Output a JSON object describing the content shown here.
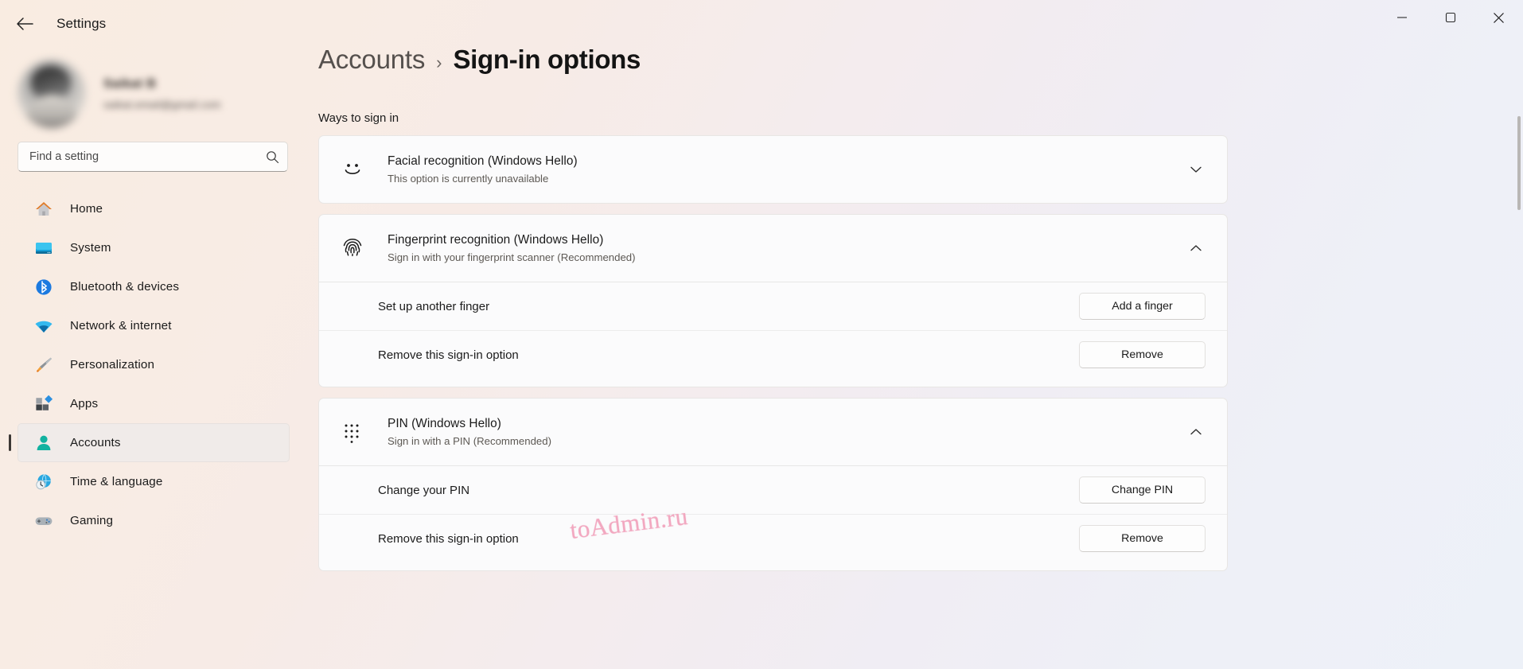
{
  "window": {
    "app_title": "Settings",
    "back_icon": "back-arrow-icon",
    "minimize_label": "—",
    "maximize_label": "☐",
    "close_label": "✕"
  },
  "profile": {
    "name": "Saikat B",
    "email": "saikat.email@gmail.com"
  },
  "search": {
    "placeholder": "Find a setting",
    "value": "",
    "icon": "search-icon"
  },
  "sidebar": {
    "items": [
      {
        "label": "Home",
        "icon": "home-icon",
        "selected": false
      },
      {
        "label": "System",
        "icon": "system-icon",
        "selected": false
      },
      {
        "label": "Bluetooth & devices",
        "icon": "bluetooth-icon",
        "selected": false
      },
      {
        "label": "Network & internet",
        "icon": "wifi-icon",
        "selected": false
      },
      {
        "label": "Personalization",
        "icon": "paintbrush-icon",
        "selected": false
      },
      {
        "label": "Apps",
        "icon": "apps-icon",
        "selected": false
      },
      {
        "label": "Accounts",
        "icon": "account-person-icon",
        "selected": true
      },
      {
        "label": "Time & language",
        "icon": "clock-globe-icon",
        "selected": false
      },
      {
        "label": "Gaming",
        "icon": "gamepad-icon",
        "selected": false
      }
    ]
  },
  "main": {
    "breadcrumb_parent": "Accounts",
    "breadcrumb_separator": "›",
    "breadcrumb_current": "Sign-in options",
    "section_title": "Ways to sign in",
    "cards": [
      {
        "icon": "face-smiley-icon",
        "title": "Facial recognition (Windows Hello)",
        "subtitle": "This option is currently unavailable",
        "expanded": false,
        "chevron": "chevron-down-icon",
        "rows": []
      },
      {
        "icon": "fingerprint-icon",
        "title": "Fingerprint recognition (Windows Hello)",
        "subtitle": "Sign in with your fingerprint scanner (Recommended)",
        "expanded": true,
        "chevron": "chevron-up-icon",
        "rows": [
          {
            "label": "Set up another finger",
            "button": "Add a finger"
          },
          {
            "label": "Remove this sign-in option",
            "button": "Remove"
          }
        ]
      },
      {
        "icon": "pin-keypad-icon",
        "title": "PIN (Windows Hello)",
        "subtitle": "Sign in with a PIN (Recommended)",
        "expanded": true,
        "chevron": "chevron-up-icon",
        "rows": [
          {
            "label": "Change your PIN",
            "button": "Change PIN"
          },
          {
            "label": "Remove this sign-in option",
            "button": "Remove"
          }
        ]
      }
    ]
  },
  "watermark": {
    "text": "toAdmin.ru",
    "color": "#f2a8c0"
  },
  "colors": {
    "accent_selected_bar": "#3c3835",
    "card_bg": "#fbfbfc",
    "page_bg_warm": "#f9ece1",
    "page_bg_cool": "#edf1f8"
  }
}
